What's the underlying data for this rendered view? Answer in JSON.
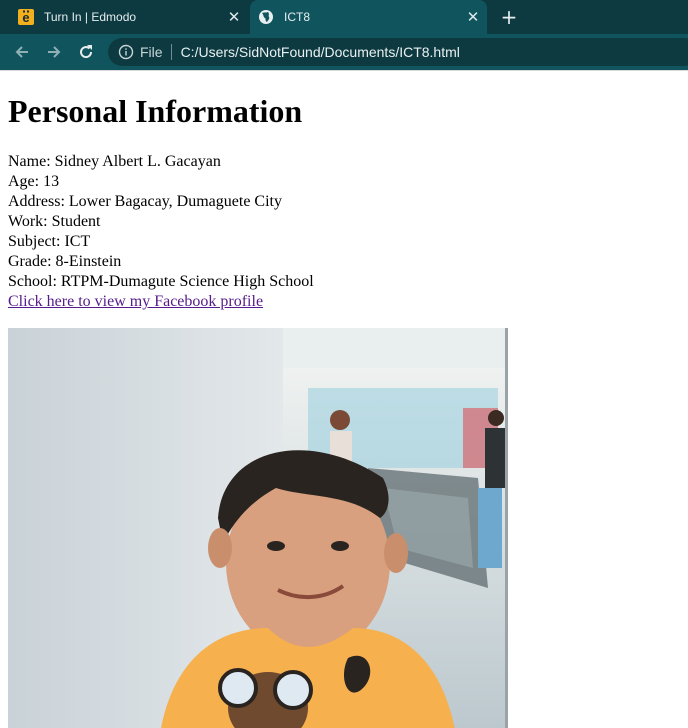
{
  "tabs": [
    {
      "title": "Turn In | Edmodo",
      "favicon": "edmodo-icon",
      "active": false
    },
    {
      "title": "ICT8",
      "favicon": "globe-icon",
      "active": true
    }
  ],
  "toolbar": {
    "back_icon": "arrow-left-icon",
    "forward_icon": "arrow-right-icon",
    "reload_icon": "reload-icon"
  },
  "address": {
    "scheme_label": "File",
    "url": "C:/Users/SidNotFound/Documents/ICT8.html"
  },
  "page": {
    "heading": "Personal Information",
    "lines": [
      "Name: Sidney Albert L. Gacayan",
      "Age: 13",
      "Address: Lower Bagacay, Dumaguete City",
      "Work: Student",
      "Subject: ICT",
      "Grade: 8-Einstein",
      "School: RTPM-Dumagute Science High School"
    ],
    "link_text": "Click here to view my Facebook profile"
  },
  "colors": {
    "tabstrip": "#0c3a40",
    "toolbar": "#10555e",
    "visited_link": "#551a8b",
    "edmodo_icon": "#f2b01e"
  }
}
